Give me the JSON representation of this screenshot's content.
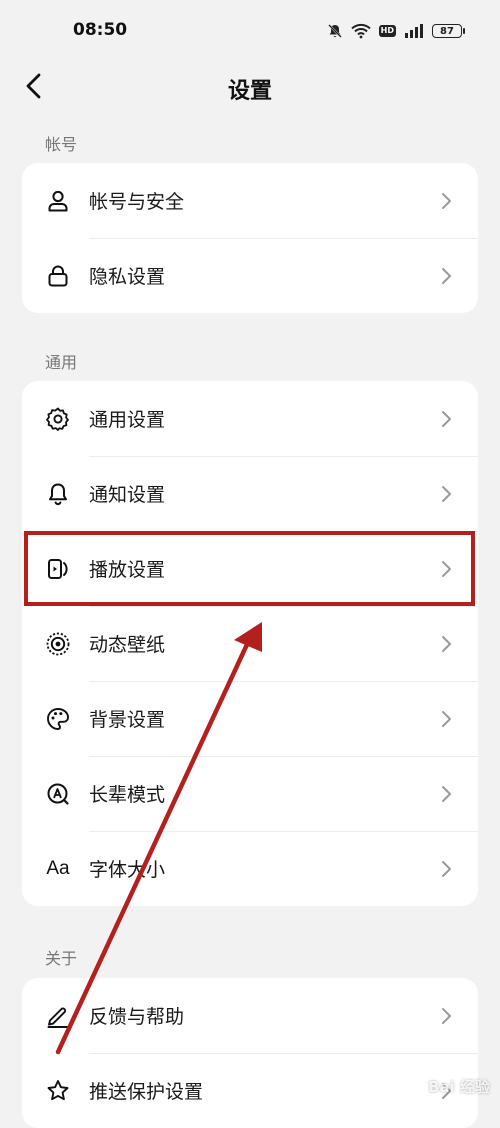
{
  "status_bar": {
    "time": "08:50",
    "hd_badge": "HD",
    "battery": "87"
  },
  "header": {
    "title": "设置"
  },
  "sections": {
    "account": {
      "header": "帐号",
      "items": [
        {
          "label": "帐号与安全",
          "icon": "person-icon"
        },
        {
          "label": "隐私设置",
          "icon": "lock-icon"
        }
      ]
    },
    "general": {
      "header": "通用",
      "items": [
        {
          "label": "通用设置",
          "icon": "gear-icon"
        },
        {
          "label": "通知设置",
          "icon": "bell-icon"
        },
        {
          "label": "播放设置",
          "icon": "play-device-icon"
        },
        {
          "label": "动态壁纸",
          "icon": "live-wallpaper-icon"
        },
        {
          "label": "背景设置",
          "icon": "palette-icon"
        },
        {
          "label": "长辈模式",
          "icon": "elder-mode-icon"
        },
        {
          "label": "字体大小",
          "icon": "font-size-icon",
          "icon_text": "Aa"
        }
      ]
    },
    "about": {
      "header": "关于",
      "items": [
        {
          "label": "反馈与帮助",
          "icon": "pencil-icon"
        },
        {
          "label": "推送保护设置",
          "icon": "star-icon"
        }
      ]
    }
  },
  "annotation": {
    "highlight_color": "#b3201e",
    "highlighted_item": "播放设置"
  },
  "watermark": "Bai 经验"
}
